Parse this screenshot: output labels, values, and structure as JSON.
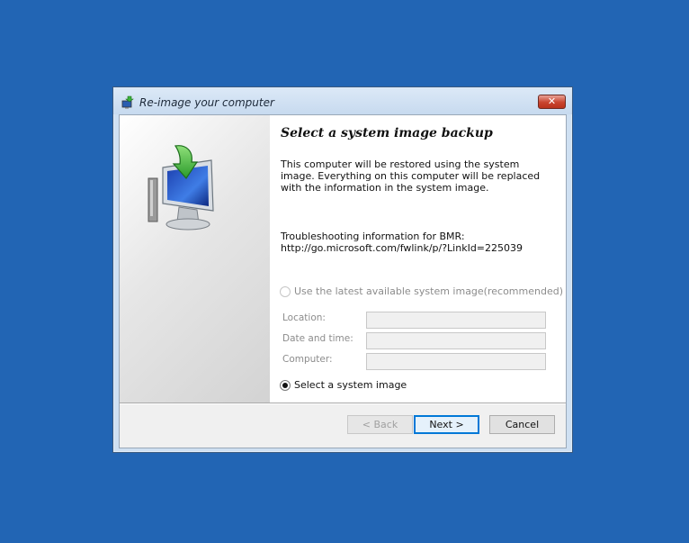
{
  "window": {
    "title": "Re-image your computer",
    "close_label": "✕"
  },
  "page": {
    "heading": "Select a system image backup",
    "description": "This computer will be restored using the system image. Everything on this computer will be replaced with the information in the system image.",
    "troubleshoot_title": "Troubleshooting information for BMR:",
    "troubleshoot_link": "http://go.microsoft.com/fwlink/p/?LinkId=225039"
  },
  "options": {
    "latest_label": "Use the latest available system image(recommended)",
    "latest_selected": false,
    "latest_enabled": false,
    "select_label": "Select a system image",
    "select_selected": true
  },
  "fields": [
    {
      "label": "Location:",
      "value": ""
    },
    {
      "label": "Date and time:",
      "value": ""
    },
    {
      "label": "Computer:",
      "value": ""
    }
  ],
  "buttons": {
    "back": "< Back",
    "next": "Next >",
    "cancel": "Cancel"
  },
  "icons": {
    "title_icon": "reimage-icon",
    "art": "computer-restore-icon",
    "close": "close-icon"
  },
  "colors": {
    "desktop": "#2265b4",
    "accent_default_button": "#0078d7",
    "close_button": "#c9442e"
  }
}
